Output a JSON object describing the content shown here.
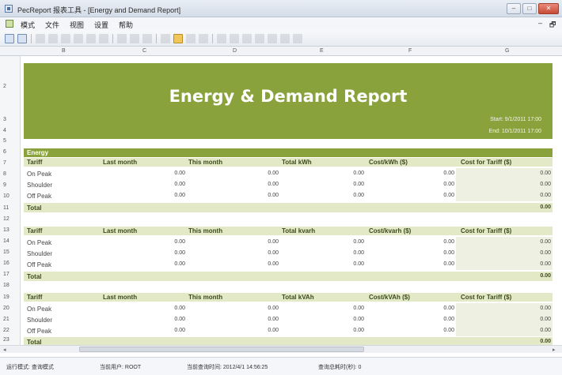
{
  "window": {
    "title": "PecReport 报表工具 - [Energy and Demand Report]",
    "controls": {
      "minimize": "–",
      "maximize": "□",
      "close": "✕"
    }
  },
  "menu": {
    "items": [
      "模式",
      "文件",
      "视图",
      "设置",
      "帮助"
    ],
    "mdi_minimize": "–",
    "mdi_restore": "🗗"
  },
  "toolbar": {
    "icons": [
      "report-view-icon",
      "edit-icon",
      "grid-icon",
      "circle-icon",
      "table-icon",
      "circle2-icon",
      "table2-icon",
      "doc-icon",
      "import-icon",
      "export-icon",
      "print-icon",
      "new-icon",
      "open-icon",
      "save-icon",
      "save-as-icon",
      "undo-icon",
      "redo-icon",
      "cut-icon",
      "copy-icon",
      "paste-icon",
      "insert-icon",
      "delete-icon"
    ]
  },
  "columns": [
    "B",
    "C",
    "D",
    "E",
    "F",
    "G"
  ],
  "rows": [
    "2",
    "3",
    "4",
    "5",
    "6",
    "7",
    "8",
    "9",
    "10",
    "11",
    "12",
    "13",
    "14",
    "15",
    "16",
    "17",
    "18",
    "19",
    "20",
    "21",
    "22",
    "23"
  ],
  "report": {
    "title": "Energy & Demand Report",
    "start": "Start: 9/1/2011  17:00",
    "end": "End: 10/1/2011  17:00",
    "section": "Energy",
    "tables": [
      {
        "headers": [
          "Tariff",
          "Last month",
          "This month",
          "Total kWh",
          "Cost/kWh ($)",
          "Cost for Tariff ($)"
        ],
        "rows": [
          {
            "label": "On Peak",
            "values": [
              "0.00",
              "0.00",
              "0.00",
              "0.00",
              "0.00"
            ]
          },
          {
            "label": "Shoulder",
            "values": [
              "0.00",
              "0.00",
              "0.00",
              "0.00",
              "0.00"
            ]
          },
          {
            "label": "Off Peak",
            "values": [
              "0.00",
              "0.00",
              "0.00",
              "0.00",
              "0.00"
            ]
          }
        ],
        "total_label": "Total",
        "total_value": "0.00"
      },
      {
        "headers": [
          "Tariff",
          "Last month",
          "This month",
          "Total kvarh",
          "Cost/kvarh ($)",
          "Cost for Tariff ($)"
        ],
        "rows": [
          {
            "label": "On Peak",
            "values": [
              "0.00",
              "0.00",
              "0.00",
              "0.00",
              "0.00"
            ]
          },
          {
            "label": "Shoulder",
            "values": [
              "0.00",
              "0.00",
              "0.00",
              "0.00",
              "0.00"
            ]
          },
          {
            "label": "Off Peak",
            "values": [
              "0.00",
              "0.00",
              "0.00",
              "0.00",
              "0.00"
            ]
          }
        ],
        "total_label": "Total",
        "total_value": "0.00"
      },
      {
        "headers": [
          "Tariff",
          "Last month",
          "This month",
          "Total kVAh",
          "Cost/kVAh ($)",
          "Cost for Tariff ($)"
        ],
        "rows": [
          {
            "label": "On Peak",
            "values": [
              "0.00",
              "0.00",
              "0.00",
              "0.00",
              "0.00"
            ]
          },
          {
            "label": "Shoulder",
            "values": [
              "0.00",
              "0.00",
              "0.00",
              "0.00",
              "0.00"
            ]
          },
          {
            "label": "Off Peak",
            "values": [
              "0.00",
              "0.00",
              "0.00",
              "0.00",
              "0.00"
            ]
          }
        ],
        "total_label": "Total",
        "total_value": "0.00"
      }
    ]
  },
  "scrollbar": {
    "left_arrow": "◂",
    "right_arrow": "▸"
  },
  "status": {
    "mode": "运行模式: 查询模式",
    "user": "当前用户: ROOT",
    "query_time": "当前查询时间: 2012/4/1 14:56:25",
    "elapsed": "查询总耗时(秒): 0"
  },
  "colors": {
    "accent": "#8aa23c",
    "header_fill": "#e3e9c7"
  }
}
